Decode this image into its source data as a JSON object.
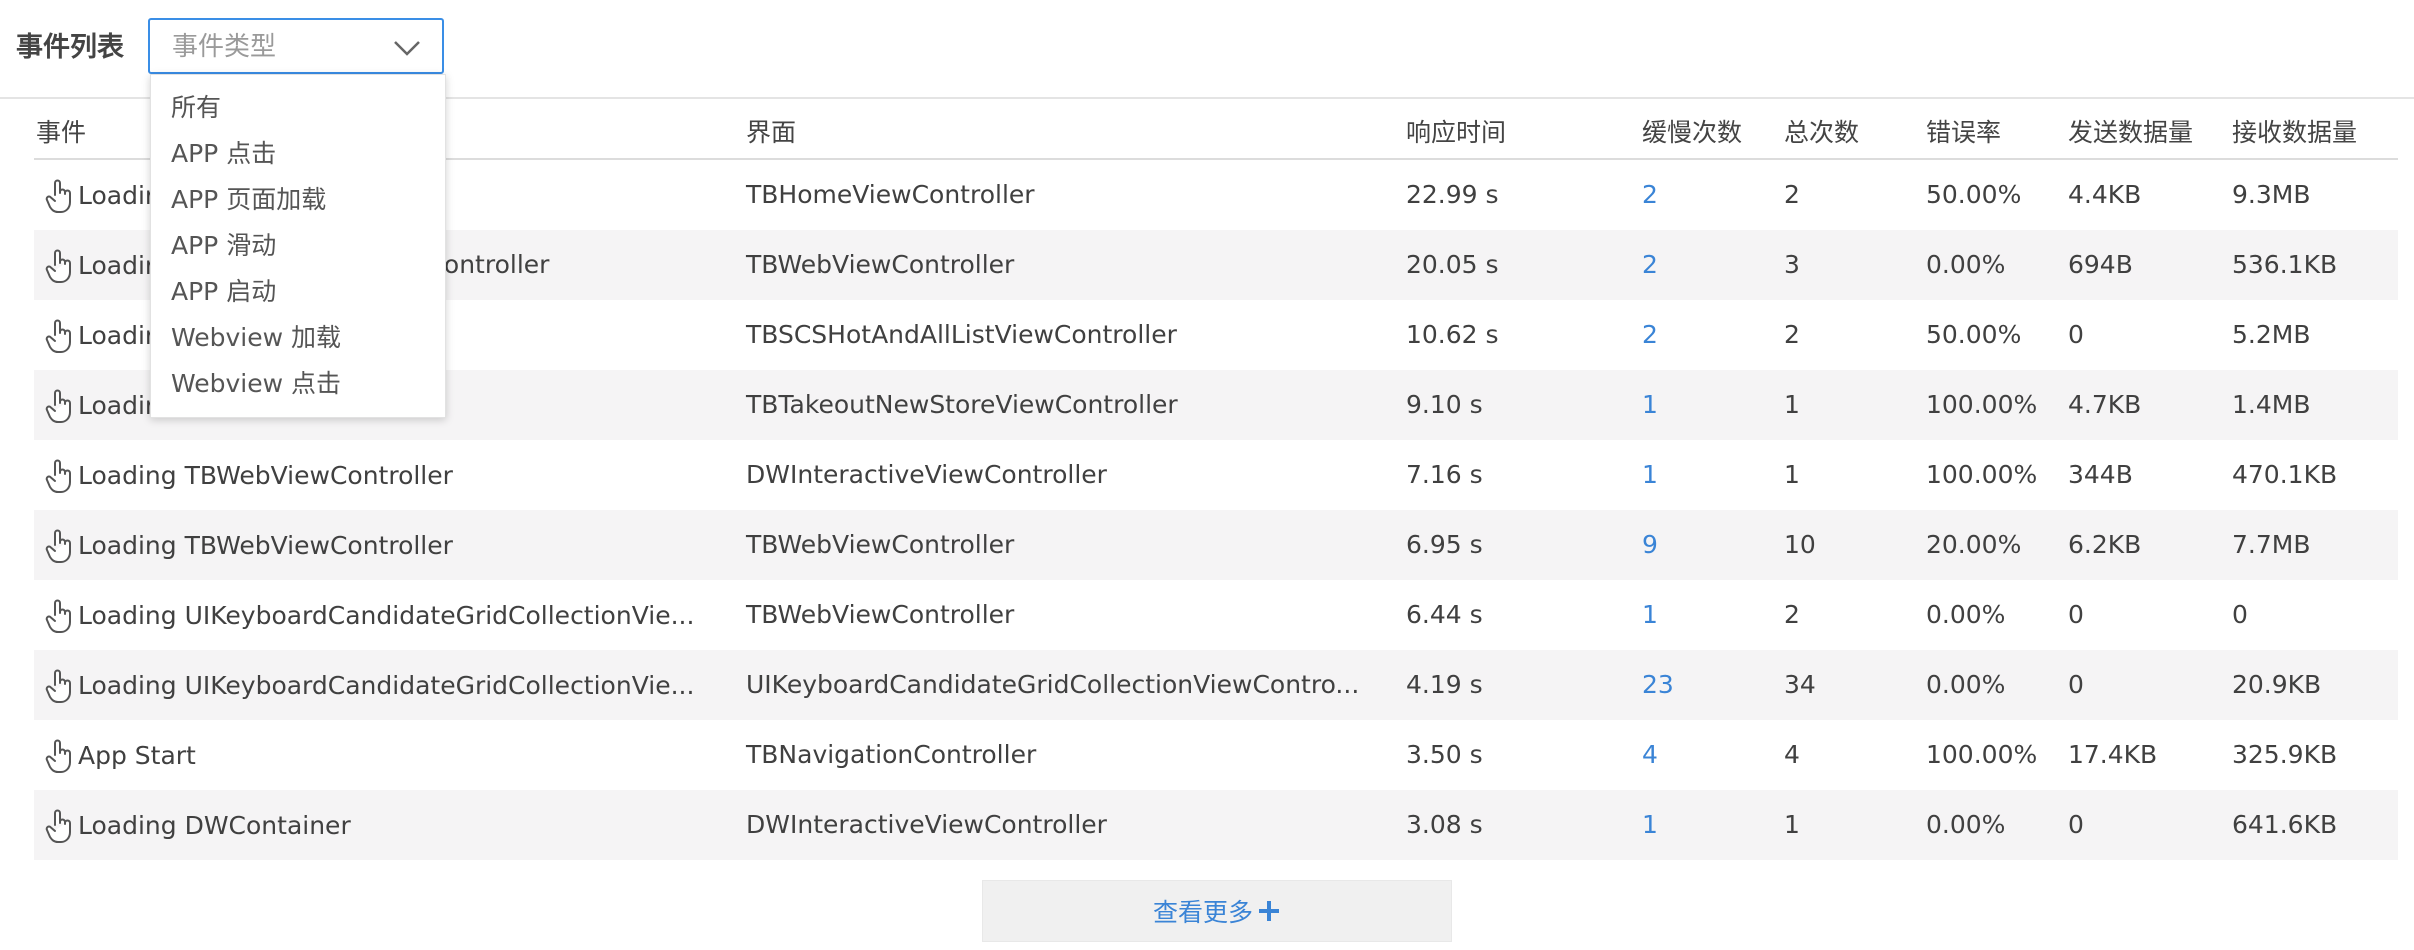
{
  "header": {
    "title": "事件列表",
    "select_placeholder": "事件类型"
  },
  "dropdown": {
    "options": [
      "所有",
      "APP 点击",
      "APP 页面加载",
      "APP 滑动",
      "APP 启动",
      "Webview 加载",
      "Webview 点击"
    ]
  },
  "table": {
    "columns": [
      "事件",
      "界面",
      "响应时间",
      "缓慢次数",
      "总次数",
      "错误率",
      "发送数据量",
      "接收数据量"
    ],
    "rows": [
      {
        "event": "Loadir",
        "view": "TBHomeViewController",
        "response": "22.99 s",
        "slow": "2",
        "total": "2",
        "error": "50.00%",
        "sent": "4.4KB",
        "received": "9.3MB"
      },
      {
        "event": "Loadir",
        "event_tail": "wController",
        "view": "TBWebViewController",
        "response": "20.05 s",
        "slow": "2",
        "total": "3",
        "error": "0.00%",
        "sent": "694B",
        "received": "536.1KB"
      },
      {
        "event": "Loadir",
        "view": "TBSCSHotAndAllListViewController",
        "response": "10.62 s",
        "slow": "2",
        "total": "2",
        "error": "50.00%",
        "sent": "0",
        "received": "5.2MB"
      },
      {
        "event": "Loadir",
        "view": "TBTakeoutNewStoreViewController",
        "response": "9.10 s",
        "slow": "1",
        "total": "1",
        "error": "100.00%",
        "sent": "4.7KB",
        "received": "1.4MB"
      },
      {
        "event": "Loading TBWebViewController",
        "view": "DWInteractiveViewController",
        "response": "7.16 s",
        "slow": "1",
        "total": "1",
        "error": "100.00%",
        "sent": "344B",
        "received": "470.1KB"
      },
      {
        "event": "Loading TBWebViewController",
        "view": "TBWebViewController",
        "response": "6.95 s",
        "slow": "9",
        "total": "10",
        "error": "20.00%",
        "sent": "6.2KB",
        "received": "7.7MB"
      },
      {
        "event": "Loading UIKeyboardCandidateGridCollectionVie...",
        "view": "TBWebViewController",
        "response": "6.44 s",
        "slow": "1",
        "total": "2",
        "error": "0.00%",
        "sent": "0",
        "received": "0"
      },
      {
        "event": "Loading UIKeyboardCandidateGridCollectionVie...",
        "view": "UIKeyboardCandidateGridCollectionViewContro...",
        "response": "4.19 s",
        "slow": "23",
        "total": "34",
        "error": "0.00%",
        "sent": "0",
        "received": "20.9KB"
      },
      {
        "event": "App Start",
        "view": "TBNavigationController",
        "response": "3.50 s",
        "slow": "4",
        "total": "4",
        "error": "100.00%",
        "sent": "17.4KB",
        "received": "325.9KB"
      },
      {
        "event": "Loading DWContainer",
        "view": "DWInteractiveViewController",
        "response": "3.08 s",
        "slow": "1",
        "total": "1",
        "error": "0.00%",
        "sent": "0",
        "received": "641.6KB"
      }
    ]
  },
  "footer": {
    "more_label": "查看更多"
  },
  "colors": {
    "accent": "#3a84d6",
    "stripe": "#f5f4f5",
    "select_border": "#3a8ee6"
  },
  "icons": {
    "event": "hand-pointer-icon",
    "select": "chevron-down-icon",
    "more": "plus-icon"
  }
}
